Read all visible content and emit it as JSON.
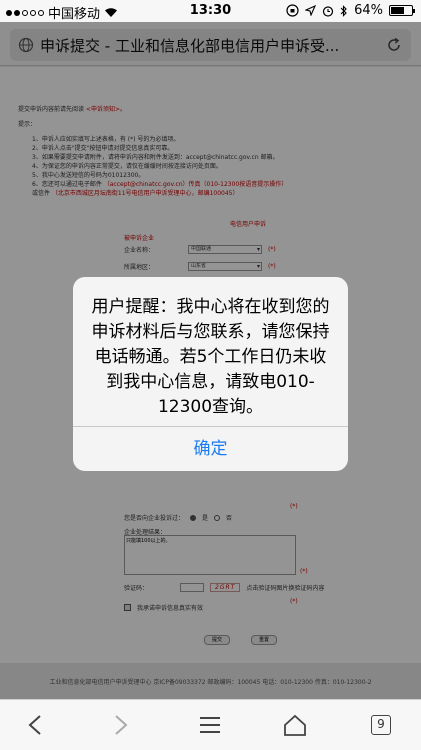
{
  "status_bar": {
    "carrier": "中国移动",
    "time": "13:30",
    "battery": "64%",
    "battery_level": 0.64
  },
  "address_bar": {
    "page_title": "申诉提交 - 工业和信息化部电信用户申诉受..."
  },
  "page": {
    "lines": [
      {
        "text": "提交申诉内容前请先阅读 ",
        "red": "<申诉须知>。"
      },
      {
        "text": "提示：",
        "red": ""
      },
      {
        "text": "1、申诉人应如实填写上述表格，有 (*) 号的为必填项。",
        "red": ""
      },
      {
        "text": "2、申诉人点击\"提交\"按钮申请对提交信息真实可靠。",
        "red": ""
      },
      {
        "text": "3、如果需要提交申请附件，请将申诉内容和附件发送到：accept@chinatcc.gov.cn 邮箱。",
        "red": ""
      },
      {
        "text": "4、为保证您的申诉内容正常提交，请仅在缓缓时间按连接访问处页面。",
        "red": ""
      },
      {
        "text": "5、我中心发送短信的号码为01012300。",
        "red": ""
      },
      {
        "text": "6、您还可以通过电子邮件 ",
        "red": "（accept@chinatcc.gov.cn）传真（010-12300按语音提示操作）"
      },
      {
        "text": "   或信件 ",
        "red": "（北京市西城区月坛南街11号电信用户申诉受理中心，邮编100045）"
      }
    ],
    "form_title": "电信用户申诉",
    "section_label": "被申诉企业",
    "company_label": "企业名称：",
    "company_value": "中国联通",
    "region_label": "所属地区：",
    "region_value": "山东省",
    "public_label": "您是否向企业投诉过：",
    "public_yes": "是",
    "public_no": "否",
    "result_label": "企业处理结果：",
    "result_placeholder": "只能填100以上的。",
    "captcha_label": "验证码：",
    "captcha_value": "2GRT",
    "captcha_hint": "点击验证码图片换验证码内容",
    "confirm_label": "我承诺申诉信息真实有效",
    "submit_label": "提交",
    "reset_label": "重置",
    "required_mark": "(*)",
    "footer": "工业和信息化部电信用户申诉受理中心   京ICP备09033372    邮政编码：100045    电话：010-12300    传真：010-12300-2"
  },
  "alert": {
    "message": "用户提醒：我中心将在收到您的申诉材料后与您联系，请您保持电话畅通。若5个工作日仍未收到我中心信息，请致电010-12300查询。",
    "ok_label": "确定"
  },
  "toolbar": {
    "tabs_count": "9"
  },
  "colors": {
    "accent": "#1a7cf2",
    "link_red": "#cc0000"
  }
}
